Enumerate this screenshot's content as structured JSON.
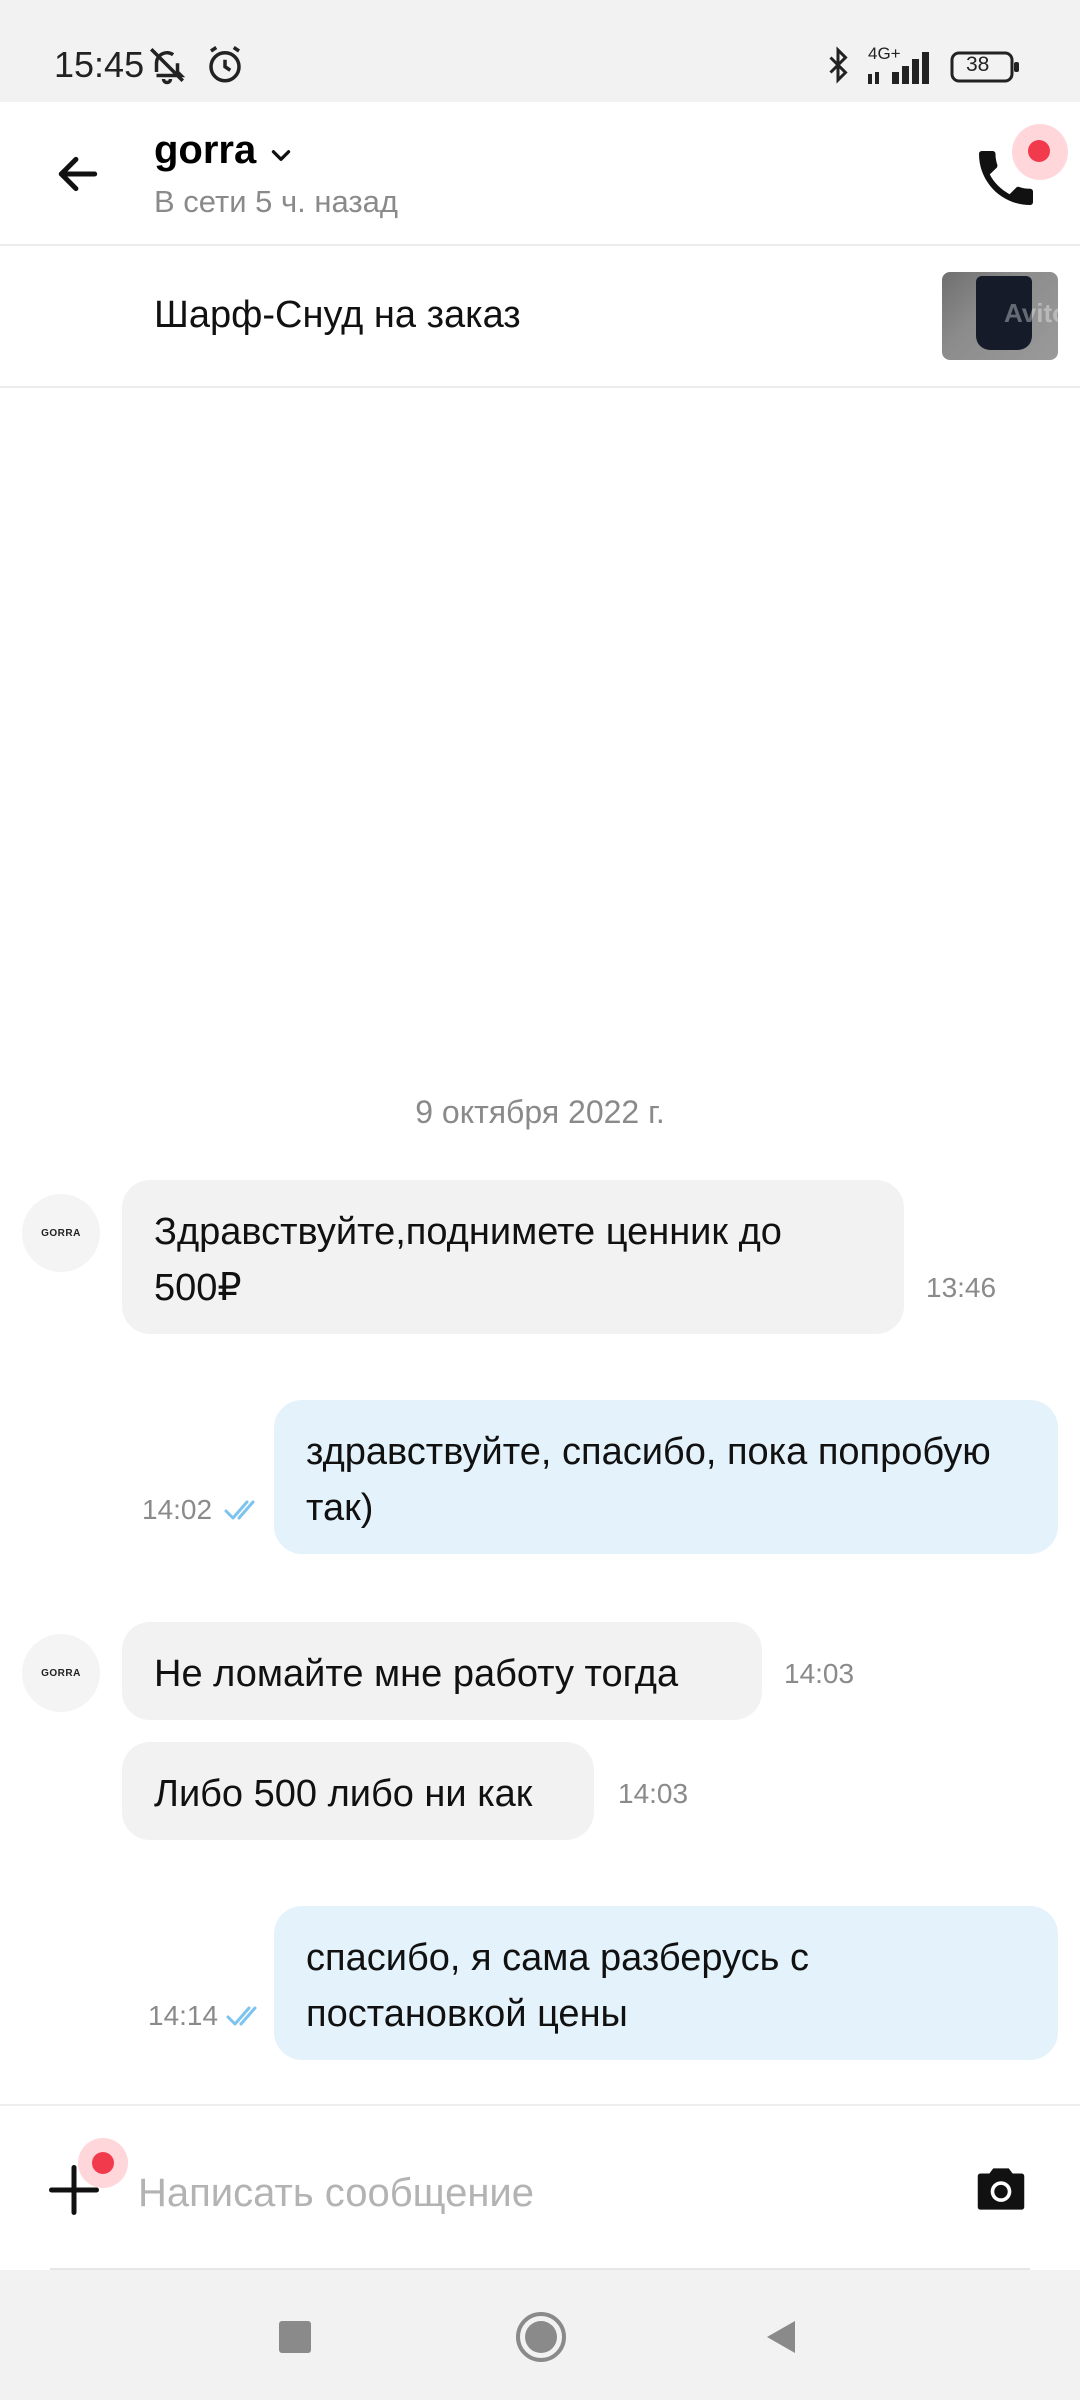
{
  "status_bar": {
    "time": "15:45",
    "network": "4G+",
    "battery": "38",
    "icons": [
      "bell-off-icon",
      "alarm-icon",
      "bluetooth-icon",
      "signal-icon",
      "battery-icon"
    ]
  },
  "header": {
    "contact_name": "gorra",
    "contact_status": "В сети 5 ч. назад",
    "back_icon": "arrow-left-icon",
    "call_icon": "phone-icon",
    "accent_color": "#f23a4d"
  },
  "item": {
    "title": "Шарф-Снуд на заказ",
    "thumbnail_watermark": "Avito"
  },
  "chat": {
    "date_separator": "9 октября 2022 г.",
    "avatar_label": "GORRA",
    "messages": [
      {
        "direction": "in",
        "text": "Здравствуйте,поднимете ценник до 500₽",
        "time": "13:46"
      },
      {
        "direction": "out",
        "text": "здравствуйте, спасибо, пока попробую так)",
        "time": "14:02",
        "read": true
      },
      {
        "direction": "in",
        "text": "Не ломайте мне работу тогда",
        "time": "14:03"
      },
      {
        "direction": "in",
        "text": "Либо 500 либо ни как",
        "time": "14:03"
      },
      {
        "direction": "out",
        "text": "спасибо, я сама разберусь с постановкой цены",
        "time": "14:14",
        "read": true
      }
    ],
    "incoming_bubble_color": "#f2f2f2",
    "outgoing_bubble_color": "#e3f2fb",
    "read_tick_color": "#7cc3ee"
  },
  "composer": {
    "placeholder": "Написать сообщение",
    "value": "",
    "attach_icon": "plus-icon",
    "camera_icon": "camera-icon"
  },
  "nav_bar": {
    "buttons": [
      "recents-square-icon",
      "home-circle-icon",
      "back-triangle-icon"
    ]
  }
}
